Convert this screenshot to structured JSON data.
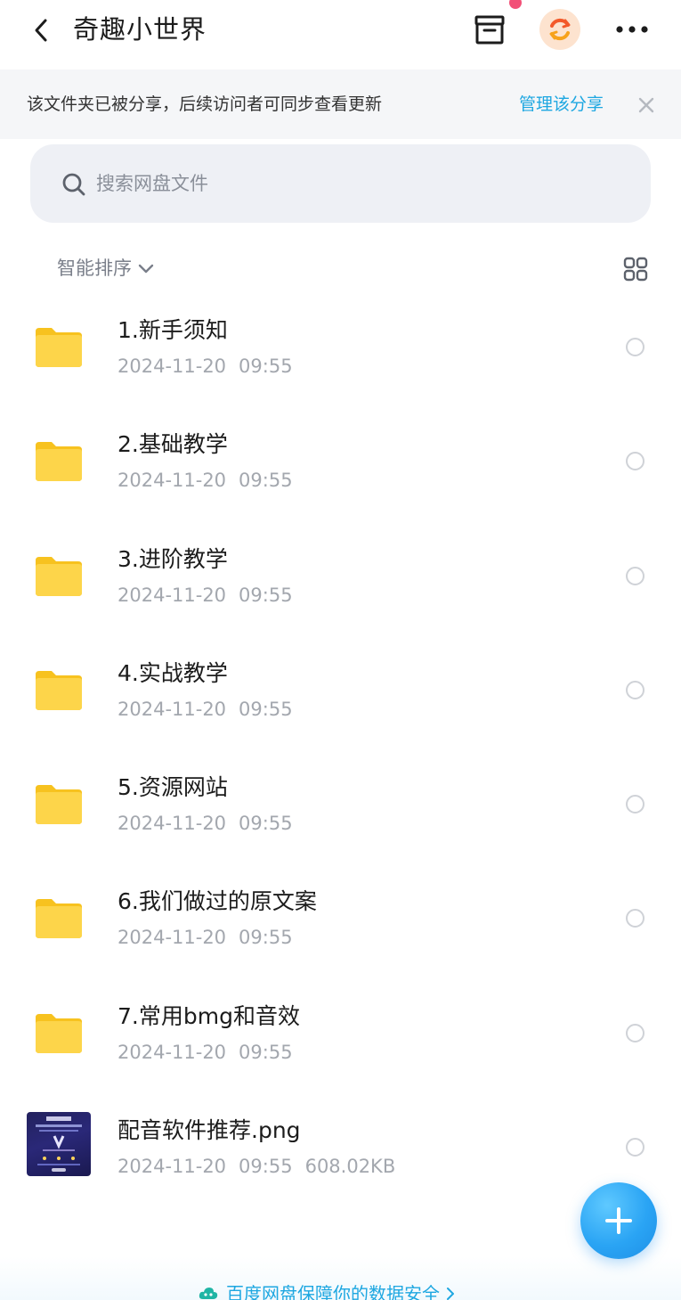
{
  "header": {
    "title": "奇趣小世界",
    "icons": [
      "back-arrow-icon",
      "inbox-icon",
      "sync-icon",
      "more-icon"
    ],
    "notification_dot_color": "#f25077",
    "sync_badge_bg": "#fde3cf"
  },
  "share_banner": {
    "message": "该文件夹已被分享，后续访问者可同步查看更新",
    "manage_label": "管理该分享",
    "accent_color": "#1ea7e1"
  },
  "search": {
    "placeholder": "搜索网盘文件"
  },
  "sort": {
    "label": "智能排序"
  },
  "files": [
    {
      "name": "1.新手须知",
      "date": "2024-11-20",
      "time": "09:55",
      "size": "",
      "type": "folder"
    },
    {
      "name": "2.基础教学",
      "date": "2024-11-20",
      "time": "09:55",
      "size": "",
      "type": "folder"
    },
    {
      "name": "3.进阶教学",
      "date": "2024-11-20",
      "time": "09:55",
      "size": "",
      "type": "folder"
    },
    {
      "name": "4.实战教学",
      "date": "2024-11-20",
      "time": "09:55",
      "size": "",
      "type": "folder"
    },
    {
      "name": "5.资源网站",
      "date": "2024-11-20",
      "time": "09:55",
      "size": "",
      "type": "folder"
    },
    {
      "name": "6.我们做过的原文案",
      "date": "2024-11-20",
      "time": "09:55",
      "size": "",
      "type": "folder"
    },
    {
      "name": "7.常用bmg和音效",
      "date": "2024-11-20",
      "time": "09:55",
      "size": "",
      "type": "folder"
    },
    {
      "name": "配音软件推荐.png",
      "date": "2024-11-20",
      "time": "09:55",
      "size": "608.02KB",
      "type": "image"
    }
  ],
  "footer": {
    "link_text": "百度网盘保障你的数据安全"
  },
  "colors": {
    "folder": "#fcd34d",
    "fab": "#2aa4f4"
  }
}
